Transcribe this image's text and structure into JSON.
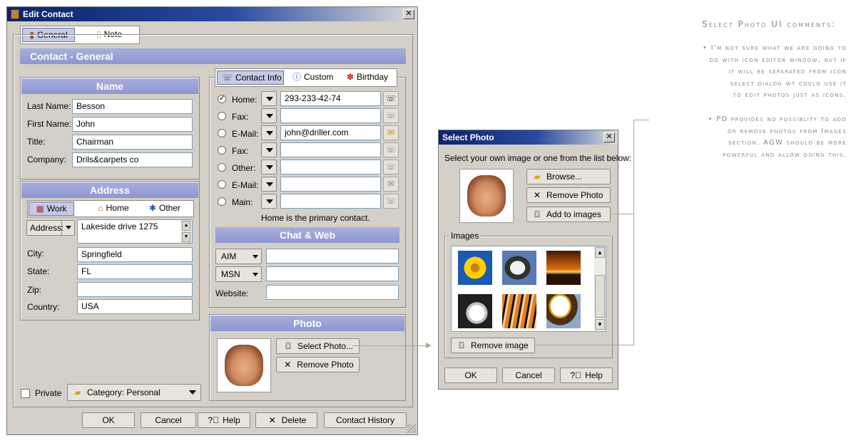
{
  "edit_contact": {
    "title": "Edit Contact",
    "tabs": [
      {
        "label": "General"
      },
      {
        "label": "Note"
      }
    ],
    "section_title": "Contact - General",
    "name": {
      "header": "Name",
      "last_name_label": "Last Name:",
      "last_name": "Besson",
      "first_name_label": "First Name:",
      "first_name": "John",
      "title_label": "Title:",
      "title": "Chairman",
      "company_label": "Company:",
      "company": "Drils&carpets co"
    },
    "address": {
      "header": "Address",
      "tabs": [
        {
          "label": "Work"
        },
        {
          "label": "Home"
        },
        {
          "label": "Other"
        }
      ],
      "address_button": "Address:",
      "address_value": "Lakeside drive 1275",
      "city_label": "City:",
      "city": "Springfield",
      "state_label": "State:",
      "state": "FL",
      "zip_label": "Zip:",
      "zip": "",
      "country_label": "Country:",
      "country": "USA"
    },
    "contact_info": {
      "tabs": [
        {
          "label": "Contact Info"
        },
        {
          "label": "Custom"
        },
        {
          "label": "Birthday"
        }
      ],
      "rows": [
        {
          "label": "Home:",
          "value": "293-233-42-74",
          "checked": true
        },
        {
          "label": "Fax:",
          "value": "",
          "checked": false
        },
        {
          "label": "E-Mail:",
          "value": "john@driller.com",
          "checked": false
        },
        {
          "label": "Fax:",
          "value": "",
          "checked": false
        },
        {
          "label": "Other:",
          "value": "",
          "checked": false
        },
        {
          "label": "E-Mail:",
          "value": "",
          "checked": false
        },
        {
          "label": "Main:",
          "value": "",
          "checked": false
        }
      ],
      "primary_note": "Home is the primary contact."
    },
    "chat_web": {
      "header": "Chat & Web",
      "aim_label": "AIM",
      "aim_value": "",
      "msn_label": "MSN",
      "msn_value": "",
      "website_label": "Website:",
      "website_value": ""
    },
    "photo": {
      "header": "Photo",
      "select_button": "Select Photo...",
      "remove_button": "Remove Photo"
    },
    "private_label": "Private",
    "category": "Category: Personal",
    "buttons": {
      "ok": "OK",
      "cancel": "Cancel",
      "help": "Help",
      "delete": "Delete",
      "history": "Contact History"
    }
  },
  "select_photo": {
    "title": "Select Photo",
    "instruction": "Select your own image or one from the list below:",
    "browse": "Browse...",
    "remove_photo": "Remove Photo",
    "add_to_images": "Add to images",
    "images_label": "Images",
    "remove_image": "Remove image",
    "ok": "OK",
    "cancel": "Cancel",
    "help": "Help"
  },
  "comments": {
    "title": "Select Photo UI comments:",
    "note1": [
      "• I'm not sure what we are going to",
      "do with icon editor window, but if",
      "it will be separated from icon",
      "select dialog wt could use it",
      "to edit photos just as icons."
    ],
    "note2": [
      "• PD provides no possiblity to add",
      "or remove photos from Images",
      "section. AGW should be more",
      "powerful and allow doing this."
    ]
  },
  "colors": {
    "section_header": "#9aa0d6",
    "titlebar": "#0a246a",
    "dialog_bg": "#d4d0c8",
    "connector": "#b0a890"
  }
}
